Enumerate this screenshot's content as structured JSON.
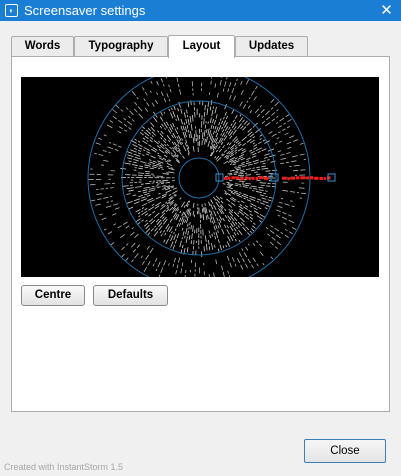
{
  "window": {
    "title": "Screensaver settings",
    "app_icon": "screensaver-app-icon",
    "close_glyph": "✕"
  },
  "tabs": [
    {
      "label": "Words",
      "active": false
    },
    {
      "label": "Typography",
      "active": false
    },
    {
      "label": "Layout",
      "active": true
    },
    {
      "label": "Updates",
      "active": false
    }
  ],
  "layout_panel": {
    "centre_button": "Centre",
    "defaults_button": "Defaults"
  },
  "footer": {
    "credit": "Created with InstantStorm 1.5",
    "close_button": "Close"
  },
  "colors": {
    "titlebar": "#1a7fd4",
    "preview_background": "#000000",
    "ring_stroke": "#1f6fa8",
    "highlight_words": "#ff1a1a"
  }
}
